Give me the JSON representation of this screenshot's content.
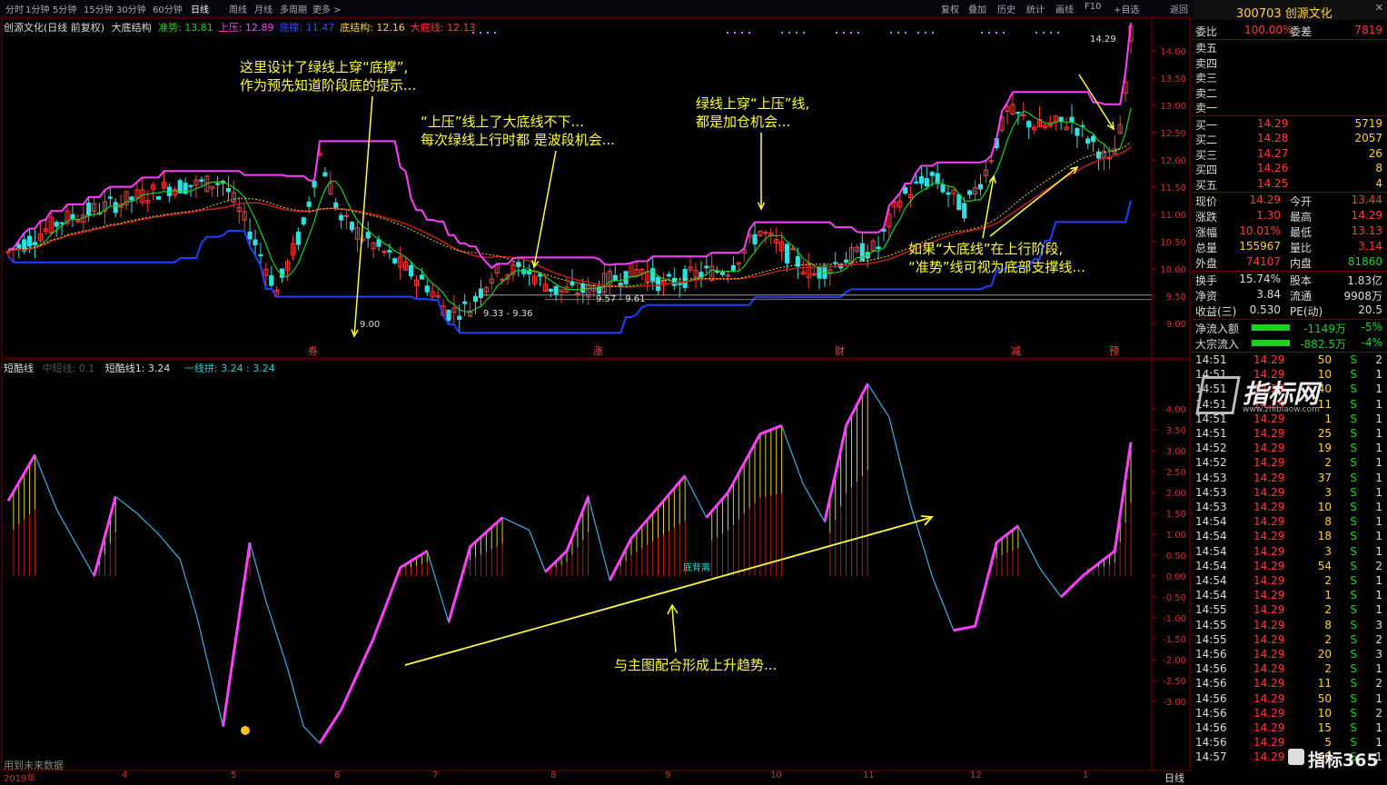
{
  "toolbar": {
    "periods": [
      "分时",
      "1分钟",
      "5分钟",
      "15分钟",
      "30分钟",
      "60分钟",
      "日线",
      "周线",
      "月线",
      "多周期",
      "更多 >"
    ],
    "active_period": "日线",
    "right_buttons": [
      "复权",
      "叠加",
      "历史",
      "统计",
      "画线",
      "F10",
      "+自选",
      "返回"
    ],
    "stock_code_name": "300703 创源文化"
  },
  "main_chart": {
    "title": "创源文化(日线 前复权)",
    "indicator_name": "大底结构",
    "values": [
      {
        "label": "准势: 13.81",
        "color": "#20d020"
      },
      {
        "label": "上压: 12.89",
        "color": "#ff40ff"
      },
      {
        "label": "底撑: 11.47",
        "color": "#3050ff"
      },
      {
        "label": "底结构: 12.16",
        "color": "#ffd23c"
      },
      {
        "label": "大底线: 12.13",
        "color": "#ff3c3c"
      }
    ],
    "price_axis": [
      "14.00",
      "13.50",
      "13.00",
      "12.50",
      "12.00",
      "11.50",
      "11.00",
      "10.50",
      "10.00",
      "9.50",
      "9.00"
    ],
    "labels": {
      "high": "14.29",
      "low1": "9.00",
      "range1": "9.33 - 9.36",
      "range2": "9.57 - 9.61"
    },
    "event_marks": [
      "券",
      "涨",
      "财",
      "减",
      "预"
    ]
  },
  "annotations": {
    "note1": [
      "这里设计了绿线上穿“底撑”,",
      "作为预先知道阶段底的提示..."
    ],
    "note2": [
      "“上压”线上了大底线不下...",
      "每次绿线上行时都 是波段机会..."
    ],
    "note3": [
      "绿线上穿“上压”线,",
      "都是加仓机会..."
    ],
    "note4": [
      "如果“大底线”在上行阶段,",
      "“准势”线可视为底部支撑线..."
    ],
    "note5": [
      "与主图配合形成上升趋势..."
    ],
    "sub_tag": "底背离"
  },
  "sub_chart": {
    "title": "短酷线",
    "params": "中短线: 0.1",
    "line1": "短酷线1: 3.24",
    "line2": "一线拼: 3.24 : 3.24",
    "axis": [
      "4.00",
      "3.50",
      "3.00",
      "2.50",
      "2.00",
      "1.50",
      "1.00",
      "0.50",
      "0.00",
      "-0.50",
      "-1.00",
      "-1.50",
      "-2.00",
      "-2.50",
      "-3.00"
    ],
    "footer": "用到未来数据"
  },
  "date_axis": [
    "2019年",
    "4",
    "5",
    "6",
    "7",
    "8",
    "9",
    "10",
    "11",
    "12",
    "1"
  ],
  "period_label": "日线",
  "sidebar": {
    "weibi": {
      "label": "委比",
      "value": "100.00%",
      "label2": "委差",
      "value2": "7819"
    },
    "sell": [
      {
        "label": "卖五",
        "price": "",
        "vol": ""
      },
      {
        "label": "卖四",
        "price": "",
        "vol": ""
      },
      {
        "label": "卖三",
        "price": "",
        "vol": ""
      },
      {
        "label": "卖二",
        "price": "",
        "vol": ""
      },
      {
        "label": "卖一",
        "price": "",
        "vol": ""
      }
    ],
    "buy": [
      {
        "label": "买一",
        "price": "14.29",
        "vol": "5719"
      },
      {
        "label": "买二",
        "price": "14.28",
        "vol": "2057"
      },
      {
        "label": "买三",
        "price": "14.27",
        "vol": "26"
      },
      {
        "label": "买四",
        "price": "14.26",
        "vol": "8"
      },
      {
        "label": "买五",
        "price": "14.25",
        "vol": "4"
      }
    ],
    "quote": [
      {
        "l1": "现价",
        "v1": "14.29",
        "l2": "今开",
        "v2": "13.44",
        "c1": "red",
        "c2": "red"
      },
      {
        "l1": "涨跌",
        "v1": "1.30",
        "l2": "最高",
        "v2": "14.29",
        "c1": "red",
        "c2": "red"
      },
      {
        "l1": "涨幅",
        "v1": "10.01%",
        "l2": "最低",
        "v2": "13.13",
        "c1": "red",
        "c2": "red"
      },
      {
        "l1": "总量",
        "v1": "155967",
        "l2": "量比",
        "v2": "3.14",
        "c1": "yellow",
        "c2": "red"
      },
      {
        "l1": "外盘",
        "v1": "74107",
        "l2": "内盘",
        "v2": "81860",
        "c1": "red",
        "c2": "green"
      }
    ],
    "fund": [
      {
        "l1": "换手",
        "v1": "15.74%",
        "l2": "股本",
        "v2": "1.83亿"
      },
      {
        "l1": "净资",
        "v1": "3.84",
        "l2": "流通",
        "v2": "9908万"
      },
      {
        "l1": "收益(三)",
        "v1": "0.530",
        "l2": "PE(动)",
        "v2": "20.5"
      }
    ],
    "flows": [
      {
        "label": "净流入额",
        "value": "-1149万",
        "pct": "-5%"
      },
      {
        "label": "大宗流入",
        "value": "-882.5万",
        "pct": "-4%"
      }
    ],
    "ticks": [
      {
        "t": "14:51",
        "p": "14.29",
        "v": "50",
        "s": "S",
        "n": "2"
      },
      {
        "t": "14:51",
        "p": "14.29",
        "v": "10",
        "s": "S",
        "n": "1"
      },
      {
        "t": "14:51",
        "p": "14.29",
        "v": "40",
        "s": "S",
        "n": "1"
      },
      {
        "t": "14:51",
        "p": "14.29",
        "v": "11",
        "s": "S",
        "n": "1"
      },
      {
        "t": "14:51",
        "p": "14.29",
        "v": "1",
        "s": "S",
        "n": "1"
      },
      {
        "t": "14:51",
        "p": "14.29",
        "v": "25",
        "s": "S",
        "n": "1"
      },
      {
        "t": "14:52",
        "p": "14.29",
        "v": "19",
        "s": "S",
        "n": "1"
      },
      {
        "t": "14:52",
        "p": "14.29",
        "v": "2",
        "s": "S",
        "n": "1"
      },
      {
        "t": "14:53",
        "p": "14.29",
        "v": "37",
        "s": "S",
        "n": "1"
      },
      {
        "t": "14:53",
        "p": "14.29",
        "v": "3",
        "s": "S",
        "n": "1"
      },
      {
        "t": "14:53",
        "p": "14.29",
        "v": "10",
        "s": "S",
        "n": "1"
      },
      {
        "t": "14:54",
        "p": "14.29",
        "v": "8",
        "s": "S",
        "n": "1"
      },
      {
        "t": "14:54",
        "p": "14.29",
        "v": "18",
        "s": "S",
        "n": "1"
      },
      {
        "t": "14:54",
        "p": "14.29",
        "v": "3",
        "s": "S",
        "n": "1"
      },
      {
        "t": "14:54",
        "p": "14.29",
        "v": "54",
        "s": "S",
        "n": "2"
      },
      {
        "t": "14:54",
        "p": "14.29",
        "v": "2",
        "s": "S",
        "n": "1"
      },
      {
        "t": "14:54",
        "p": "14.29",
        "v": "1",
        "s": "S",
        "n": "1"
      },
      {
        "t": "14:55",
        "p": "14.29",
        "v": "2",
        "s": "S",
        "n": "1"
      },
      {
        "t": "14:55",
        "p": "14.29",
        "v": "8",
        "s": "S",
        "n": "3"
      },
      {
        "t": "14:55",
        "p": "14.29",
        "v": "2",
        "s": "S",
        "n": "2"
      },
      {
        "t": "14:56",
        "p": "14.29",
        "v": "20",
        "s": "S",
        "n": "3"
      },
      {
        "t": "14:56",
        "p": "14.29",
        "v": "2",
        "s": "S",
        "n": "1"
      },
      {
        "t": "14:56",
        "p": "14.29",
        "v": "11",
        "s": "S",
        "n": "2"
      },
      {
        "t": "14:56",
        "p": "14.29",
        "v": "50",
        "s": "S",
        "n": "1"
      },
      {
        "t": "14:56",
        "p": "14.29",
        "v": "10",
        "s": "S",
        "n": "2"
      },
      {
        "t": "14:56",
        "p": "14.29",
        "v": "15",
        "s": "S",
        "n": "1"
      },
      {
        "t": "14:56",
        "p": "14.29",
        "v": "5",
        "s": "S",
        "n": "1"
      },
      {
        "t": "14:57",
        "p": "14.29",
        "v": "60",
        "s": "S",
        "n": "1"
      }
    ]
  },
  "watermarks": {
    "top": "指标网",
    "top_url": "www.zhibiaow.com",
    "bottom": "指标365"
  }
}
